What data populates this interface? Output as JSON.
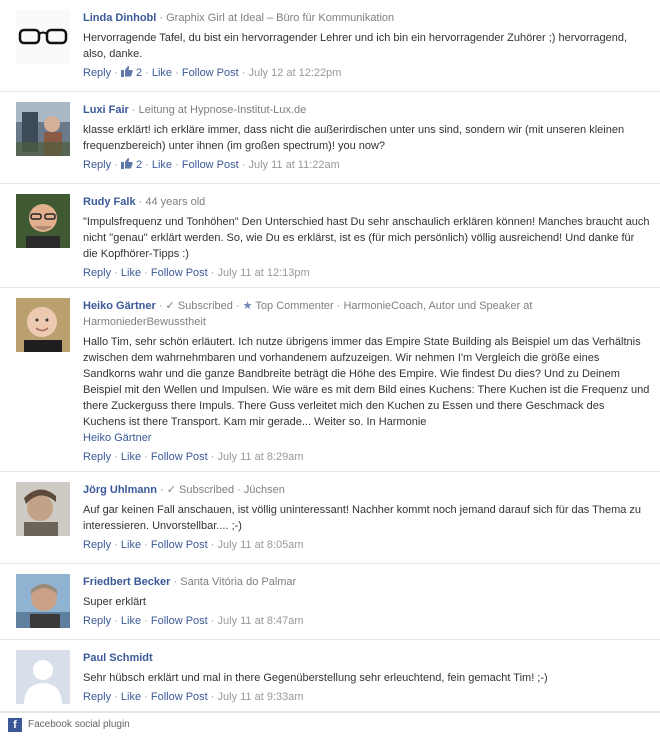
{
  "comments": [
    {
      "name": "Linda Dinhobl",
      "meta": "Graphix Girl at Ideal – Büro für Kommunikation",
      "text": "Hervorragende Tafel, du bist ein hervorragender Lehrer und ich bin ein hervorragender Zuhörer ;) hervorragend, also, danke.",
      "reply": "Reply",
      "likes": "2",
      "like": "Like",
      "follow": "Follow Post",
      "date": "July 12 at 12:22pm",
      "avatar": "glasses-avatar"
    },
    {
      "name": "Luxi Fair",
      "meta": "Leitung at Hypnose-Institut-Lux.de",
      "text": "klasse erklärt! ich erkläre immer, dass nicht die außerirdischen unter uns sind, sondern wir (mit unseren kleinen frequenzbereich) unter ihnen (im großen spectrum)! you now?",
      "reply": "Reply",
      "likes": "2",
      "like": "Like",
      "follow": "Follow Post",
      "date": "July 11 at 11:22am",
      "avatar": "luxi-avatar"
    },
    {
      "name": "Rudy Falk",
      "meta": "44 years old",
      "text": "\"Impulsfrequenz und Tonhöhen\" Den Unterschied hast Du sehr anschaulich erklären können! Manches braucht auch nicht \"genau\" erklärt werden. So, wie Du es erklärst, ist es (für mich persönlich) völlig ausreichend! Und danke für die Kopfhörer-Tipps :)",
      "reply": "Reply",
      "like": "Like",
      "follow": "Follow Post",
      "date": "July 11 at 12:13pm",
      "avatar": "rudy-avatar"
    },
    {
      "name": "Heiko Gärtner",
      "subscribed": "Subscribed",
      "topcommenter": "Top Commenter",
      "meta": "HarmonieCoach, Autor und Speaker at HarmoniederBewusstheit",
      "text": "Hallo Tim, sehr schön erläutert. Ich nutze übrigens immer das Empire State Building als Beispiel um das Verhältnis zwischen dem wahrnehmbaren und vorhandenem aufzuzeigen. Wir nehmen I'm Vergleich die größe eines Sandkorns wahr und die ganze Bandbreite beträgt die Höhe des Empire. Wie findest Du dies? Und zu Deinem Beispiel mit den Wellen und Impulsen. Wie wäre es mit dem Bild eines Kuchens: There Kuchen ist die Frequenz und there Zuckerguss there Impuls. There Guss verleitet mich den Kuchen zu Essen und there Geschmack des Kuchens ist there Transport. Kam mir gerade... Weiter so. In Harmonie",
      "signature": "Heiko Gärtner",
      "reply": "Reply",
      "like": "Like",
      "follow": "Follow Post",
      "date": "July 11 at 8:29am",
      "avatar": "heiko-avatar"
    },
    {
      "name": "Jörg Uhlmann",
      "subscribed": "Subscribed",
      "meta": "Jüchsen",
      "text": "Auf gar keinen Fall anschauen, ist völlig uninteressant! Nachher kommt noch jemand darauf sich für das Thema zu interessieren. Unvorstellbar.... ;-)",
      "reply": "Reply",
      "like": "Like",
      "follow": "Follow Post",
      "date": "July 11 at 8:05am",
      "avatar": "joerg-avatar"
    },
    {
      "name": "Friedbert Becker",
      "meta": "Santa Vitória do Palmar",
      "text": "Super erklärt",
      "reply": "Reply",
      "like": "Like",
      "follow": "Follow Post",
      "date": "July 11 at 8:47am",
      "avatar": "friedbert-avatar"
    },
    {
      "name": "Paul Schmidt",
      "text": "Sehr hübsch erklärt und mal in there Gegenüberstellung sehr erleuchtend, fein gemacht Tim! ;-)",
      "reply": "Reply",
      "like": "Like",
      "follow": "Follow Post",
      "date": "July 11 at 9:33am",
      "avatar": "default-avatar"
    }
  ],
  "footer": {
    "icon": "facebook-icon",
    "text": "Facebook social plugin"
  },
  "colors": {
    "link": "#3b5998",
    "meta": "#808080",
    "text": "#333333"
  }
}
